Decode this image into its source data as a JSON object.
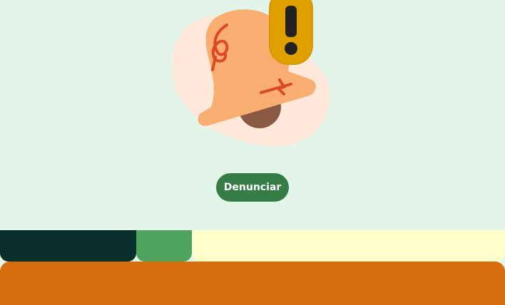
{
  "hero": {
    "illustration_icon": "bell-alert-icon",
    "report_button_label": "Denunciar"
  },
  "colors": {
    "hero_background": "#e3f5e9",
    "button_background": "#367c47",
    "bell_body": "#f8ad71",
    "bell_blob": "#ffe8da",
    "bell_clapper": "#8a5a45",
    "bell_scribble": "#dc4a24",
    "alert_badge": "#e0a000",
    "alert_mark": "#222222",
    "band_dark": "#0a2e2b",
    "band_green": "#4ea35e",
    "band_cream": "#fffdca",
    "band_orange": "#d86d0e"
  }
}
